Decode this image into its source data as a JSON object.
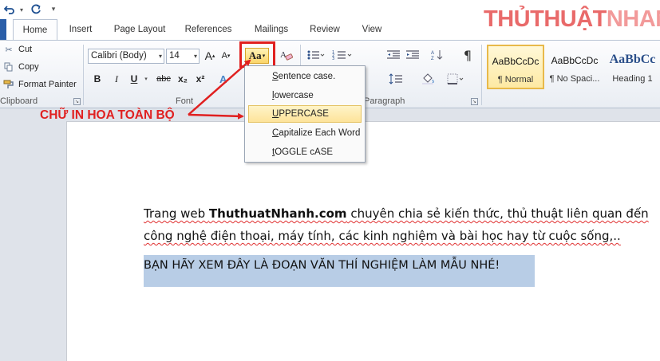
{
  "qat": {
    "save_icon": "save-icon",
    "undo_icon": "undo-icon",
    "redo_icon": "redo-icon"
  },
  "tabs": [
    {
      "label": "Home",
      "active": true
    },
    {
      "label": "Insert"
    },
    {
      "label": "Page Layout"
    },
    {
      "label": "References"
    },
    {
      "label": "Mailings"
    },
    {
      "label": "Review"
    },
    {
      "label": "View"
    }
  ],
  "brand": {
    "part1": "THỦTHUẬT",
    "part2": "NHANH"
  },
  "clipboard": {
    "cut_label": "Cut",
    "copy_label": "Copy",
    "format_painter_label": "Format Painter",
    "group_label": "Clipboard"
  },
  "font": {
    "font_name": "Calibri (Body)",
    "font_size": "14",
    "group_label": "Font",
    "bold": "B",
    "italic": "I",
    "underline": "U",
    "strike": "abc",
    "subscript": "x₂",
    "superscript": "x²",
    "grow": "A",
    "shrink": "A",
    "change_case": "Aa"
  },
  "paragraph": {
    "group_label": "Paragraph",
    "show_marks": "¶"
  },
  "styles": [
    {
      "sample": "AaBbCcDc",
      "name": "¶ Normal",
      "selected": true
    },
    {
      "sample": "AaBbCcDc",
      "name": "¶ No Spaci..."
    },
    {
      "sample": "AaBbCc",
      "name": "Heading 1"
    }
  ],
  "change_case_menu": [
    {
      "pre": "",
      "key": "S",
      "post": "entence case."
    },
    {
      "pre": "",
      "key": "l",
      "post": "owercase"
    },
    {
      "pre": "",
      "key": "U",
      "post": "PPERCASE",
      "hover": true
    },
    {
      "pre": "",
      "key": "C",
      "post": "apitalize Each Word"
    },
    {
      "pre": "",
      "key": "t",
      "post": "OGGLE cASE"
    }
  ],
  "callout": "CHỮ IN HOA TOÀN BỘ",
  "document": {
    "line1_a": "Trang web ",
    "line1_bold": "ThuthuatNhanh.com",
    "line1_b": " chuyên chia sẻ kiến thức, thủ thuật liên quan đến",
    "line2": "công nghệ điện thoại, máy tính, các kinh nghiệm và bài học hay từ cuộc sống,..",
    "selected_line": "BẠN HÃY XEM ĐÂY LÀ ĐOẠN VĂN THÍ NGHIỆM LÀM MẪU NHÉ!"
  },
  "colors": {
    "accent_red": "#e02020",
    "selection": "#b8cde6",
    "file_tab": "#2a5ea8"
  }
}
